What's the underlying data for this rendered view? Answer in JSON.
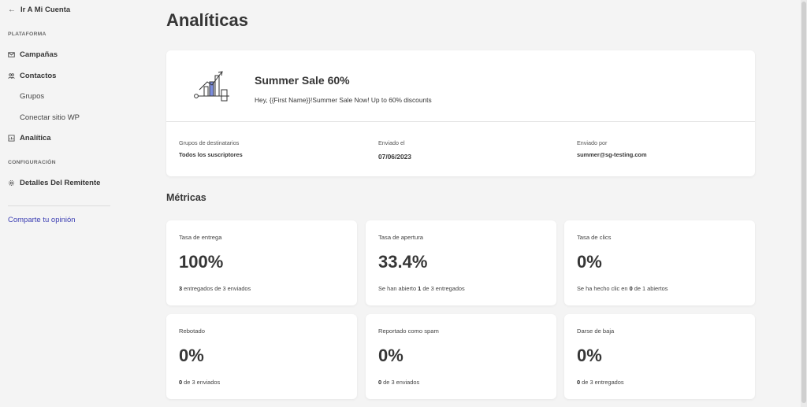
{
  "sidebar": {
    "back_label": "Ir A Mi Cuenta",
    "platform_label": "PLATAFORMA",
    "campaigns": "Campañas",
    "contacts": "Contactos",
    "groups": "Grupos",
    "connect_wp": "Conectar sitio WP",
    "analytics": "Analítica",
    "config_label": "CONFIGURACIÓN",
    "sender_details": "Detalles Del Remitente",
    "feedback": "Comparte tu opinión"
  },
  "page": {
    "title": "Analíticas"
  },
  "campaign": {
    "name": "Summer Sale 60%",
    "preview": "Hey, {{First Name}}!Summer Sale Now! Up to 60% discounts",
    "recipients_label": "Grupos de destinatarios",
    "recipients_value": "Todos los suscriptores",
    "sent_on_label": "Enviado el",
    "sent_on_value": "07/06/2023",
    "sent_by_label": "Enviado por",
    "sent_by_value": "summer@sg-testing.com"
  },
  "metrics": {
    "title": "Métricas",
    "items": [
      {
        "label": "Tasa de entrega",
        "value": "100%",
        "desc_pre": "",
        "desc_num": "3",
        "desc_post": " entregados de 3 enviados"
      },
      {
        "label": "Tasa de apertura",
        "value": "33.4%",
        "desc_pre": "Se han abierto ",
        "desc_num": "1",
        "desc_post": " de 3 entregados"
      },
      {
        "label": "Tasa de clics",
        "value": "0%",
        "desc_pre": "Se ha hecho clic en ",
        "desc_num": "0",
        "desc_post": " de 1 abiertos"
      },
      {
        "label": "Rebotado",
        "value": "0%",
        "desc_pre": "",
        "desc_num": "0",
        "desc_post": " de 3 enviados"
      },
      {
        "label": "Reportado como spam",
        "value": "0%",
        "desc_pre": "",
        "desc_num": "0",
        "desc_post": " de 3 enviados"
      },
      {
        "label": "Darse de baja",
        "value": "0%",
        "desc_pre": "",
        "desc_num": "0",
        "desc_post": " de 3 entregados"
      }
    ]
  },
  "colors": {
    "accent_link": "#3c3fb3",
    "illustration_accent": "#7b8cde"
  },
  "icons": {
    "back": "arrow-left-icon",
    "campaigns": "envelope-icon",
    "contacts": "users-icon",
    "analytics": "chart-icon",
    "sender": "gear-icon"
  }
}
